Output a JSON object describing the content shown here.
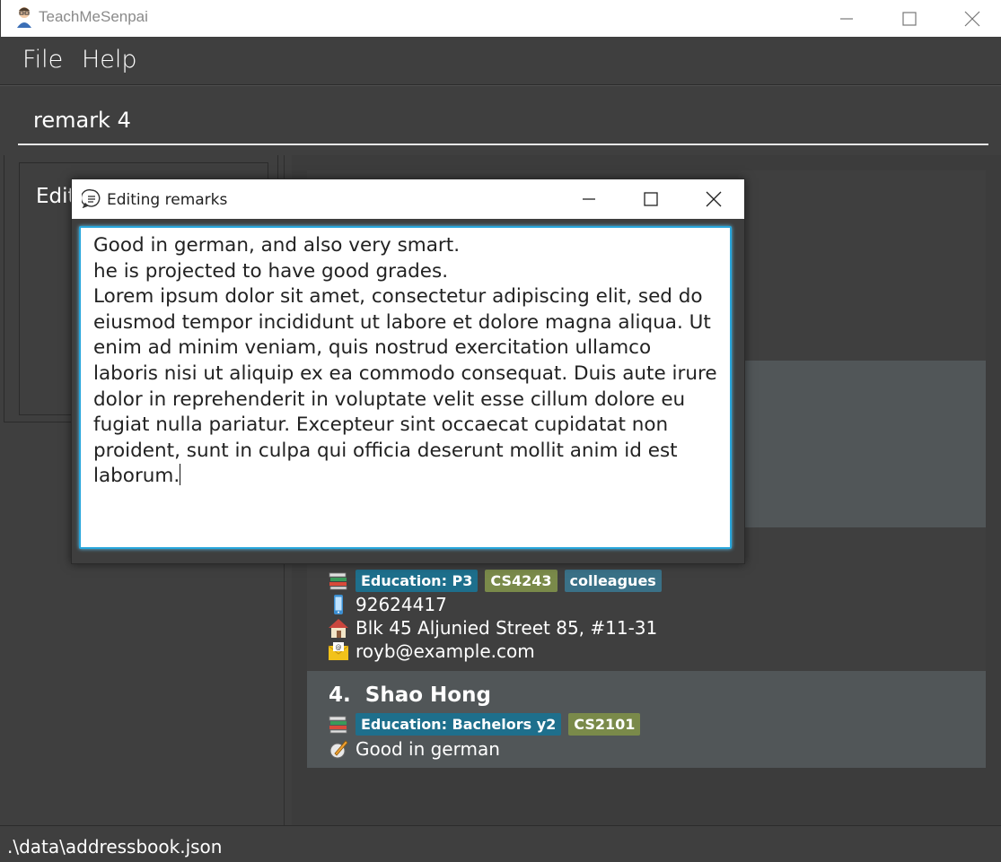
{
  "window": {
    "title": "TeachMeSenpai"
  },
  "menu": {
    "items": [
      {
        "label": "File"
      },
      {
        "label": "Help"
      }
    ]
  },
  "command": {
    "value": "remark 4"
  },
  "result": {
    "text": "Edit"
  },
  "persons": {
    "roy": {
      "tags": [
        {
          "label": "Education: P3",
          "color": "#1e6f8c"
        },
        {
          "label": "CS4243",
          "color": "#7a8a4a"
        },
        {
          "label": "colleagues",
          "color": "#3a7187"
        }
      ],
      "phone": "92624417",
      "address": "Blk 45 Aljunied Street 85, #11-31",
      "email": "royb@example.com"
    },
    "shao": {
      "index": "4.",
      "name": "Shao Hong",
      "tags": [
        {
          "label": "Education: Bachelors y2",
          "color": "#1e6f8c"
        },
        {
          "label": "CS2101",
          "color": "#7a8a4a"
        }
      ],
      "remark": "Good in german"
    }
  },
  "status": {
    "path": ".\\data\\addressbook.json"
  },
  "dialog": {
    "title": "Editing remarks",
    "content": "Good in german, and also very smart.\nhe is projected to have good grades.\nLorem ipsum dolor sit amet, consectetur adipiscing elit, sed do eiusmod tempor incididunt ut labore et dolore magna aliqua. Ut enim ad minim veniam, quis nostrud exercitation ullamco laboris nisi ut aliquip ex ea commodo consequat. Duis aute irure dolor in reprehenderit in voluptate velit esse cillum dolore eu fugiat nulla pariatur. Excepteur sint occaecat cupidatat non proident, sunt in culpa qui officia deserunt mollit anim id est laborum."
  },
  "icons": {
    "app": "teacher-avatar-icon",
    "education": "books-icon",
    "phone": "phone-icon",
    "address": "house-icon",
    "email": "envelope-icon",
    "remark": "remark-pen-icon",
    "dialog": "chat-bubble-icon"
  }
}
